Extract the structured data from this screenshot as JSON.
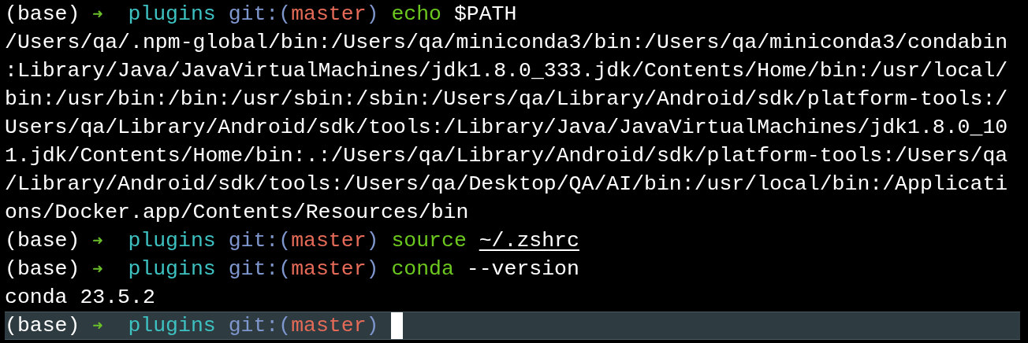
{
  "terminal": {
    "lines": [
      {
        "kind": "prompt",
        "current": false,
        "env": "(base)",
        "arrow": "➜",
        "directory": "plugins",
        "git_label": "git:(",
        "branch": "master",
        "git_close": ")",
        "command": "echo",
        "argument": "$PATH",
        "argument_underlined": false
      },
      {
        "kind": "output",
        "lines": [
          "/Users/qa/.npm-global/bin:/Users/qa/miniconda3/bin:/Users/qa/miniconda3/condabin",
          ":Library/Java/JavaVirtualMachines/jdk1.8.0_333.jdk/Contents/Home/bin:/usr/local/",
          "bin:/usr/bin:/bin:/usr/sbin:/sbin:/Users/qa/Library/Android/sdk/platform-tools:/",
          "Users/qa/Library/Android/sdk/tools:/Library/Java/JavaVirtualMachines/jdk1.8.0_10",
          "1.jdk/Contents/Home/bin:.:/Users/qa/Library/Android/sdk/platform-tools:/Users/qa",
          "/Library/Android/sdk/tools:/Users/qa/Desktop/QA/AI/bin:/usr/local/bin:/Applicati",
          "ons/Docker.app/Contents/Resources/bin"
        ]
      },
      {
        "kind": "prompt",
        "current": false,
        "env": "(base)",
        "arrow": "➜",
        "directory": "plugins",
        "git_label": "git:(",
        "branch": "master",
        "git_close": ")",
        "command": "source",
        "argument": "~/.zshrc",
        "argument_underlined": true
      },
      {
        "kind": "prompt",
        "current": false,
        "env": "(base)",
        "arrow": "➜",
        "directory": "plugins",
        "git_label": "git:(",
        "branch": "master",
        "git_close": ")",
        "command": "conda",
        "argument": "--version",
        "argument_underlined": false
      },
      {
        "kind": "output",
        "lines": [
          "conda 23.5.2"
        ]
      },
      {
        "kind": "prompt",
        "current": true,
        "env": "(base)",
        "arrow": "➜",
        "directory": "plugins",
        "git_label": "git:(",
        "branch": "master",
        "git_close": ")"
      }
    ]
  }
}
